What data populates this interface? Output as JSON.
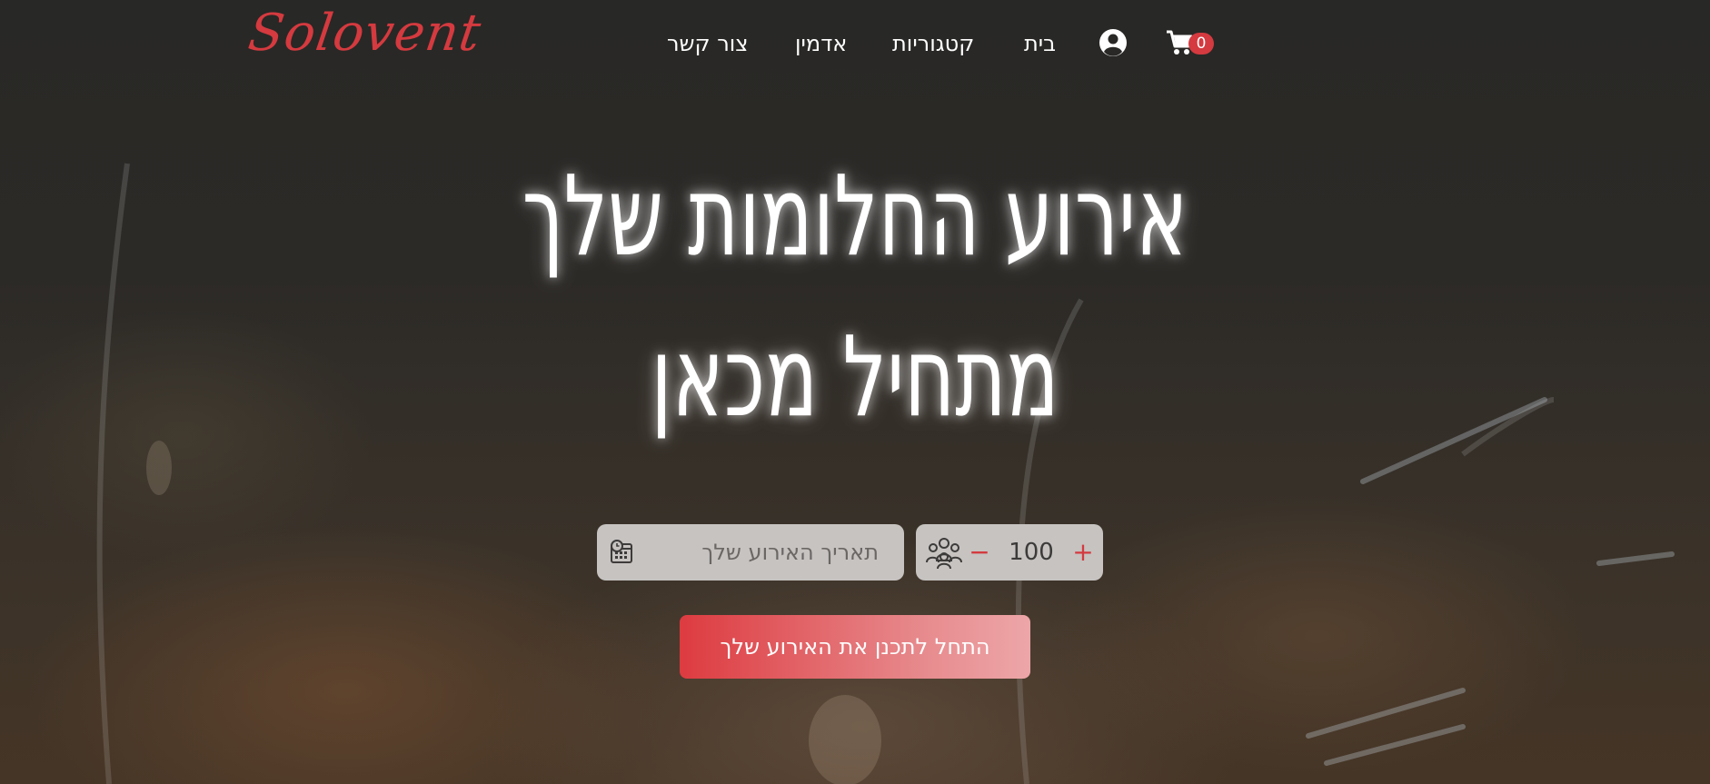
{
  "brand": {
    "logo_text": "Solovent",
    "accent_color": "#d43a3f"
  },
  "nav": {
    "items": [
      {
        "label": "בית"
      },
      {
        "label": "קטגוריות"
      },
      {
        "label": "אדמין"
      },
      {
        "label": "צור קשר"
      }
    ],
    "cart": {
      "count": "0",
      "icon": "cart-icon"
    },
    "user": {
      "icon": "user-circle-icon"
    }
  },
  "hero": {
    "headline_line1": "אירוע החלומות שלך",
    "headline_line2": "מתחיל מכאן"
  },
  "search": {
    "date_placeholder": "תאריך האירוע שלך",
    "date_icon": "calendar-clock-icon",
    "guests_icon": "people-group-icon",
    "guest_count": "100",
    "minus_symbol": "−",
    "plus_symbol": "+"
  },
  "cta": {
    "label": "התחל לתכנן את האירוע שלך"
  }
}
